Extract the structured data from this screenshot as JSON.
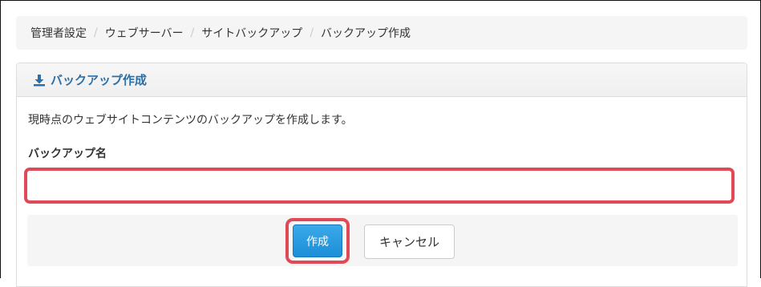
{
  "breadcrumb": {
    "items": [
      "管理者設定",
      "ウェブサーバー",
      "サイトバックアップ",
      "バックアップ作成"
    ],
    "separator": "/"
  },
  "panel": {
    "title": "バックアップ作成",
    "title_icon": "download-icon",
    "description": "現時点のウェブサイトコンテンツのバックアップを作成します。",
    "field_label": "バックアップ名",
    "input_value": "",
    "input_placeholder": ""
  },
  "actions": {
    "create_label": "作成",
    "cancel_label": "キャンセル"
  },
  "colors": {
    "heading_text": "#2a6fa8",
    "primary_button": "#1b8fd8",
    "highlight": "#e04a57"
  }
}
